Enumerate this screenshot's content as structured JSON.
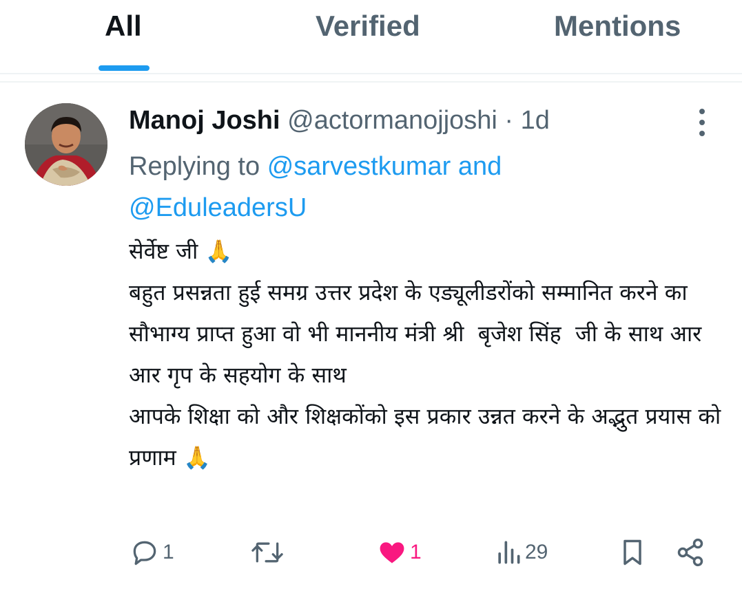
{
  "tabs": [
    {
      "label": "All",
      "active": true
    },
    {
      "label": "Verified",
      "active": false
    },
    {
      "label": "Mentions",
      "active": false
    }
  ],
  "tweet": {
    "author_name": "Manoj Joshi",
    "handle": "@actormanojjoshi",
    "separator": "·",
    "time": "1d",
    "replying_prefix": "Replying to",
    "replying_mention_1": "@sarvestkumar",
    "replying_and": "and",
    "replying_mention_2": "@EduleadersU",
    "body_text": "सेर्वेष्ट जी 🙏\nबहुत प्रसन्नता हुई समग्र उत्तर प्रदेश के एड्यूलीडरोंको सम्मानित करने का सौभाग्य प्राप्त हुआ वो भी माननीय मंत्री श्री  बृजेश सिंह  जी के साथ आर आर गृप के सहयोग के साथ\nआपके शिक्षा को और शिक्षकोंको इस प्रकार उन्नत करने के अद्भुत प्रयास को प्रणाम 🙏",
    "actions": {
      "reply_count": "1",
      "retweet_count": "",
      "like_count": "1",
      "views_count": "29"
    },
    "icons": {
      "reply": "reply-icon",
      "retweet": "retweet-icon",
      "like": "heart-icon",
      "views": "views-icon",
      "bookmark": "bookmark-icon",
      "share": "share-icon",
      "more": "more-icon"
    }
  },
  "colors": {
    "accent": "#1d9bf0",
    "text_secondary": "#536471",
    "like": "#f91880",
    "divider": "#eff3f4"
  }
}
